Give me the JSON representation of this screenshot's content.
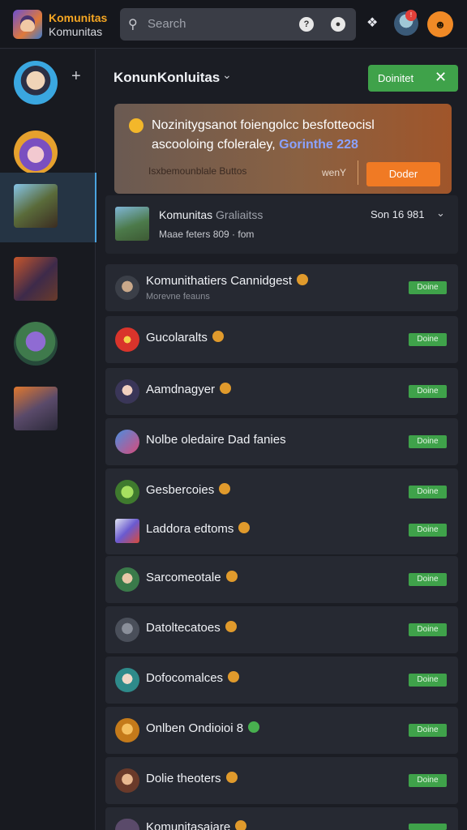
{
  "app": {
    "title": "Komunitas",
    "subtitle": "Komunitas"
  },
  "search": {
    "placeholder": "Search"
  },
  "header": {
    "title": "KonunKonluitas",
    "join_label": "Doinitet"
  },
  "rail": {
    "items": [
      {
        "name": "avatar-1"
      },
      {
        "name": "avatar-2"
      },
      {
        "name": "game-3"
      },
      {
        "name": "game-4"
      },
      {
        "name": "game-5"
      },
      {
        "name": "game-6"
      }
    ]
  },
  "promo": {
    "line1": "Nozinitygsanot foiengolcc besfotteocisl",
    "line2_text": "ascooloing cfoleraley, ",
    "line2_highlight": "Gorinthe 228",
    "small": "Isxbemounblale Buttos",
    "tag": "wenY",
    "cta": "Doder"
  },
  "featured": {
    "name": "Komunitas",
    "name_muted": "Graliaitss",
    "meta": "Maae feters 809 · fom",
    "date": "Son 16 981"
  },
  "status_label": "Doine",
  "rows": [
    {
      "label": "Komunithatiers Cannidgest",
      "sub": "Morevne feauns"
    },
    {
      "label": "Gucolaralts"
    },
    {
      "label": "Aamdnagyer"
    },
    {
      "label": "Nolbe oledaire Dad fanies"
    },
    {
      "label": "Gesbercoies"
    },
    {
      "label": "Laddora edtoms"
    },
    {
      "label": "Sarcomeotale"
    },
    {
      "label": "Datoltecatoes"
    },
    {
      "label": "Dofocomalces"
    },
    {
      "label": "Onlben Ondioioi 8"
    },
    {
      "label": "Dolie theoters"
    },
    {
      "label": "Komunitasaiare"
    }
  ],
  "colors": {
    "accent": "#3fa24a",
    "brand": "#f5a623",
    "cta": "#f07a24"
  }
}
